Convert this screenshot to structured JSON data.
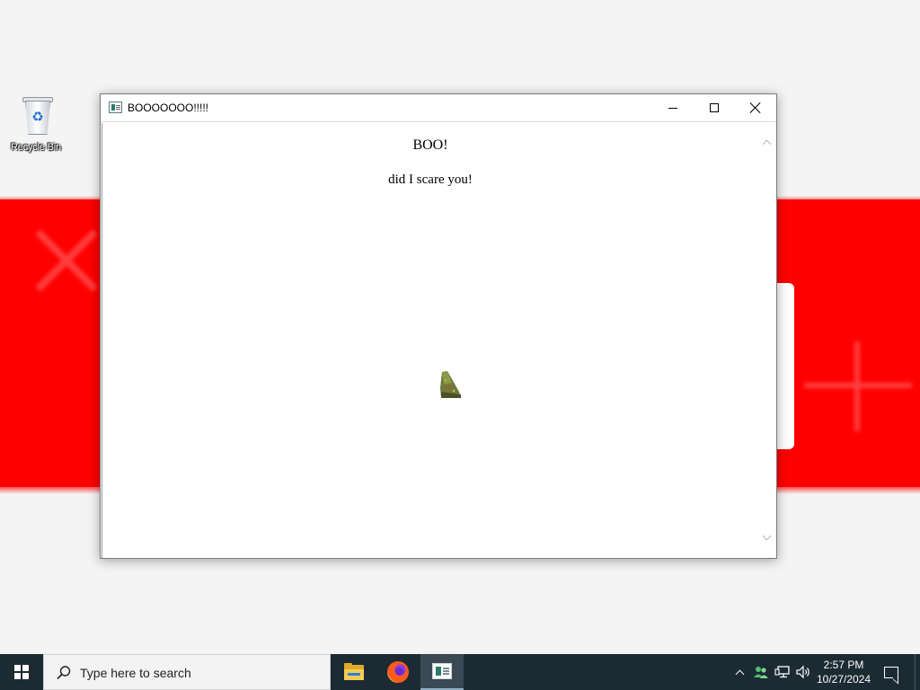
{
  "desktop": {
    "icons": [
      {
        "label": "Recycle Bin",
        "icon": "recycle-bin-icon"
      }
    ],
    "wallpaper_colors": {
      "background": "#f4f4f4",
      "band": "#ff0000"
    }
  },
  "window": {
    "title": "BOOOOOOO!!!!!",
    "icon": "app-window-icon",
    "controls": {
      "minimize": "minimize-icon",
      "maximize": "maximize-icon",
      "close": "close-icon"
    },
    "content": {
      "heading": "BOO!",
      "message": "did I scare you!",
      "image": "witch-hat-icon"
    }
  },
  "taskbar": {
    "start": "windows-logo-icon",
    "search": {
      "placeholder": "Type here to search"
    },
    "apps": [
      {
        "name": "File Explorer",
        "icon": "file-explorer-icon",
        "active": false
      },
      {
        "name": "Firefox",
        "icon": "firefox-icon",
        "active": false
      },
      {
        "name": "BOOOOOOO!!!!!",
        "icon": "app-window-icon",
        "active": true
      }
    ],
    "tray": {
      "icons": [
        "chevron-up-icon",
        "people-icon",
        "network-icon",
        "volume-icon"
      ],
      "time": "2:57 PM",
      "date": "10/27/2024",
      "notifications": "notification-icon"
    }
  },
  "colors": {
    "taskbar": "#1c2a33",
    "window_bg": "#ffffff"
  }
}
